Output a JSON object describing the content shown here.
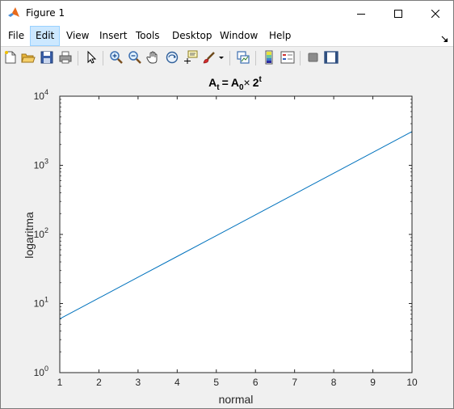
{
  "window": {
    "title": "Figure 1",
    "controls": {
      "minimize": "minimize-icon",
      "maximize": "maximize-icon",
      "close": "close-icon"
    }
  },
  "menubar": {
    "items": [
      "File",
      "Edit",
      "View",
      "Insert",
      "Tools",
      "Desktop",
      "Window",
      "Help"
    ],
    "active_index": 1
  },
  "toolbar": {
    "icons": [
      "new-figure-icon",
      "open-file-icon",
      "save-icon",
      "print-icon",
      "pointer-icon",
      "zoom-in-icon",
      "zoom-out-icon",
      "pan-hand-icon",
      "rotate-3d-icon",
      "data-cursor-icon",
      "brush-icon",
      "brush-dropdown-icon",
      "link-plot-icon",
      "colorbar-icon",
      "legend-icon",
      "hide-plot-tools-icon",
      "show-plot-tools-icon"
    ]
  },
  "colors": {
    "line": "#0072bd",
    "axes_bg": "#ffffff",
    "figure_bg": "#f0f0f0",
    "menu_active_bg": "#cce8ff"
  },
  "chart_data": {
    "type": "line",
    "title": "At = A0× 2t",
    "title_parts": {
      "A_main": "A",
      "t_sub": "t",
      "eq": "=",
      "A0_main": "A",
      "zero_sub": "0",
      "times": "×",
      "two": "2",
      "t_sup": "t"
    },
    "xlabel": "normal",
    "ylabel": "logaritma",
    "xlim": [
      1,
      10
    ],
    "ylim": [
      1,
      10000
    ],
    "yscale": "log",
    "grid": false,
    "x_ticks": [
      "1",
      "2",
      "3",
      "4",
      "5",
      "6",
      "7",
      "8",
      "9",
      "10"
    ],
    "y_ticks": [
      {
        "base": "10",
        "exp": "0",
        "value": 1
      },
      {
        "base": "10",
        "exp": "1",
        "value": 10
      },
      {
        "base": "10",
        "exp": "2",
        "value": 100
      },
      {
        "base": "10",
        "exp": "3",
        "value": 1000
      },
      {
        "base": "10",
        "exp": "4",
        "value": 10000
      }
    ],
    "series": [
      {
        "x": [
          1,
          2,
          3,
          4,
          5,
          6,
          7,
          8,
          9,
          10
        ],
        "values": [
          6,
          12,
          24,
          48,
          96,
          192,
          384,
          768,
          1536,
          3072
        ]
      }
    ]
  }
}
